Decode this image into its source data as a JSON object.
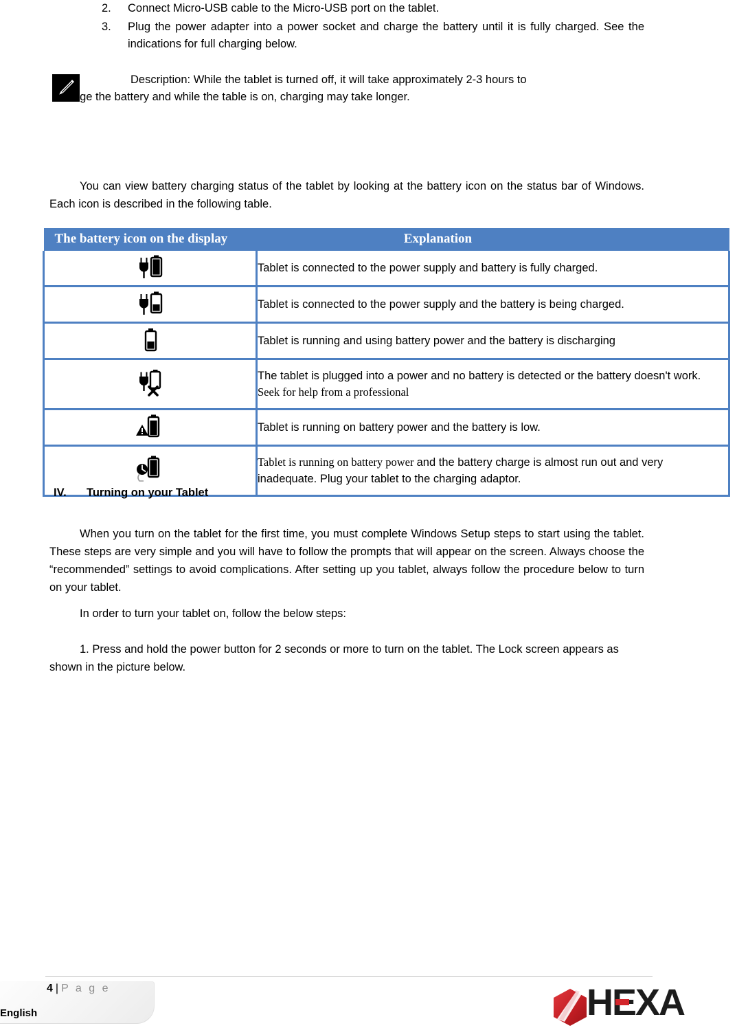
{
  "steps": [
    {
      "num": "2.",
      "text": "Connect Micro-USB cable to the Micro-USB port on the tablet."
    },
    {
      "num": "3.",
      "text": "Plug the power adapter into a power socket and charge the battery until it is fully charged. See the indications for full charging below."
    }
  ],
  "note": {
    "icon": "pencil-note-icon",
    "line1": "Description: While the tablet is turned off, it will take approximately 2-3 hours to",
    "line2": "charge the battery and while the table is on, charging may take longer."
  },
  "intro": "You can view battery charging status of the tablet by looking at the battery icon on the status bar of Windows. Each icon is described in the following table.",
  "table": {
    "header_color": "#4E80C2",
    "columns": [
      "The battery icon on the display",
      "Explanation"
    ],
    "rows": [
      {
        "icon": "battery-plug-full-icon",
        "text": "Tablet is connected to the power supply and battery is fully charged."
      },
      {
        "icon": "battery-plug-charging-icon",
        "text": "Tablet is connected to the power supply and the battery is being charged."
      },
      {
        "icon": "battery-discharging-icon",
        "text": "Tablet is running and using battery power and the battery is discharging"
      },
      {
        "icon": "battery-no-battery-x-icon",
        "text": "The tablet is plugged into a power and no battery is detected or the battery doesn't work. ",
        "text_serif": "Seek for help from a professional"
      },
      {
        "icon": "battery-low-warning-icon",
        "text": "Tablet is running on battery power and the battery is low."
      },
      {
        "icon": "battery-critical-icon",
        "text_serif_lead": "Tablet is running on battery power ",
        "text": "and the battery charge is almost run out and very inadequate. Plug your tablet to the charging adaptor."
      }
    ]
  },
  "section": {
    "numeral": "IV.",
    "title": "Turning on your Tablet",
    "paragraph1": "When you turn on the tablet for the first time, you must complete Windows Setup steps to start using the tablet. These steps are very simple and you will have to follow the prompts that will appear on the screen. Always choose the “recommended” settings to avoid complications. After setting up you tablet, always follow the procedure below to turn on your tablet.",
    "paragraph2": "In order to turn your tablet on, follow the below steps:",
    "paragraph3": "1. Press and hold the power button for 2 seconds or more to turn on the tablet. The Lock screen appears as shown in the picture below."
  },
  "footer": {
    "page_number": "4",
    "separator": "|",
    "page_word": "P a g e",
    "language": "English",
    "logo_text": "HEXA",
    "logo_color": "#CC2229",
    "logo_accent": "#E8383F"
  }
}
